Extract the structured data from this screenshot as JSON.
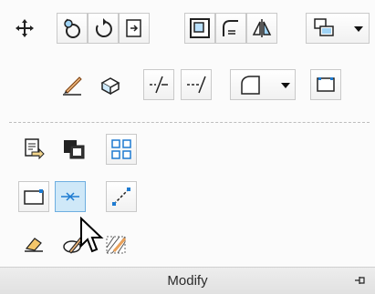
{
  "panel": {
    "title": "Modify",
    "pin_icon": "pin-icon"
  },
  "toolbar": {
    "row1": [
      "move-icon",
      "rotate-icon",
      "refresh-rotate-icon",
      "insert-icon",
      "stretch-icon",
      "fillet-icon",
      "mirror-icon",
      "array-dropdown-icon"
    ],
    "row2": [
      "erase-brush-icon",
      "block-3d-icon",
      "trim-icon",
      "extend-icon",
      "fillet-dropdown-icon",
      "explode-icon"
    ],
    "expanded": [
      "export-icon",
      "copy-clip-icon",
      "array-grid-icon",
      "rect-point-icon",
      "join-icon",
      "align-line-icon",
      "eraser-icon",
      "edit-hatch-icon",
      "hatch-icon"
    ]
  }
}
